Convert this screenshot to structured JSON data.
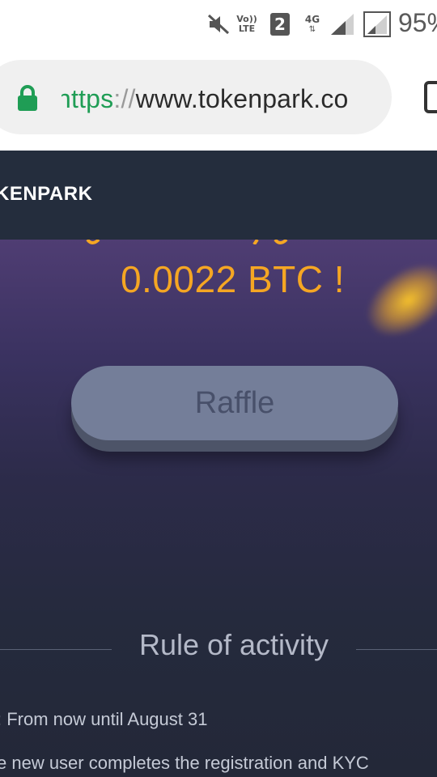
{
  "status_bar": {
    "battery_text": "95%",
    "sim_badge": "2",
    "network_labels": [
      "Vo))",
      "LTE",
      "4G"
    ],
    "icons": [
      "mute-icon",
      "volte-icon",
      "sim-icon",
      "4g-data-icon",
      "signal-icon",
      "signal-icon-2"
    ]
  },
  "browser": {
    "url_scheme": "https",
    "url_separator": "://",
    "url_host": "www.tokenpark.co",
    "url_display": "https://www.tokenpark.co",
    "lock_color": "#1f9d55",
    "icons": [
      "lock-icon",
      "tabs-icon"
    ]
  },
  "header": {
    "logo": "KENPARK"
  },
  "hero": {
    "prize_text": "0.0022 BTC !",
    "prize_color": "#f5a623",
    "raffle_label": "Raffle"
  },
  "rules": {
    "title": "Rule of activity",
    "lines": [
      ": From now until August 31",
      "e new user completes the registration and KYC"
    ]
  }
}
